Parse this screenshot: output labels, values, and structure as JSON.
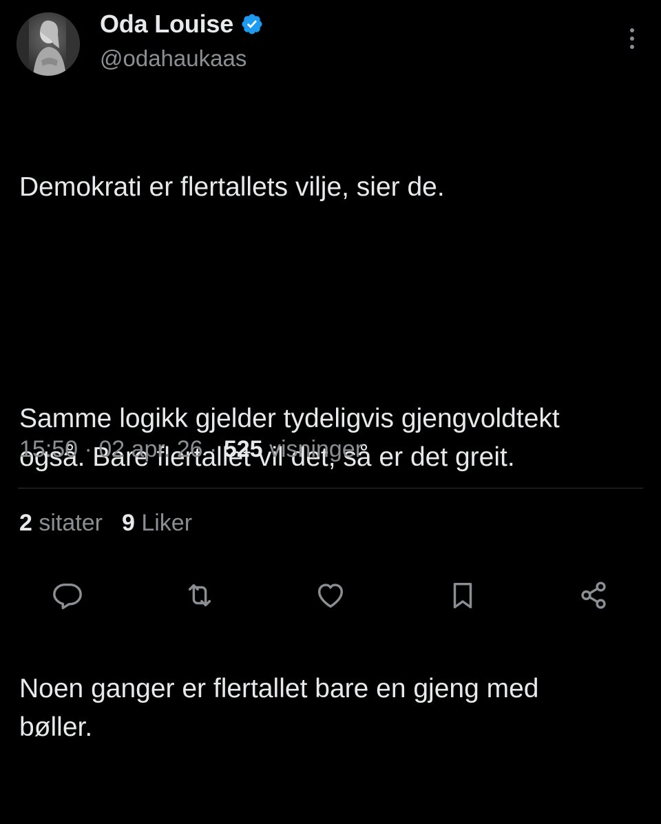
{
  "author": {
    "display_name": "Oda Louise",
    "handle": "@odahaukaas",
    "verified": true,
    "avatar": "avatar-photo"
  },
  "tweet": {
    "paragraphs": [
      "Demokrati er flertallets vilje, sier de.",
      "Samme logikk gjelder tydeligvis gjengvoldtekt også. Bare flertallet vil det, så er det greit.",
      "Noen ganger er flertallet bare en gjeng med bøller."
    ],
    "time": "15:50",
    "date": "02 apr. 26",
    "views_count": "525",
    "views_label": "visninger",
    "separator": "·"
  },
  "stats": {
    "quotes_count": "2",
    "quotes_label": "sitater",
    "likes_count": "9",
    "likes_label": "Liker"
  },
  "actions": [
    {
      "name": "reply",
      "icon": "reply-icon"
    },
    {
      "name": "retweet",
      "icon": "retweet-icon"
    },
    {
      "name": "like",
      "icon": "heart-icon"
    },
    {
      "name": "bookmark",
      "icon": "bookmark-icon"
    },
    {
      "name": "share",
      "icon": "share-icon"
    }
  ],
  "colors": {
    "background": "#000000",
    "primary_text": "#e7e9ea",
    "secondary_text": "#8b8f93",
    "verified_blue": "#1d9bf0",
    "divider": "#2f3336"
  }
}
